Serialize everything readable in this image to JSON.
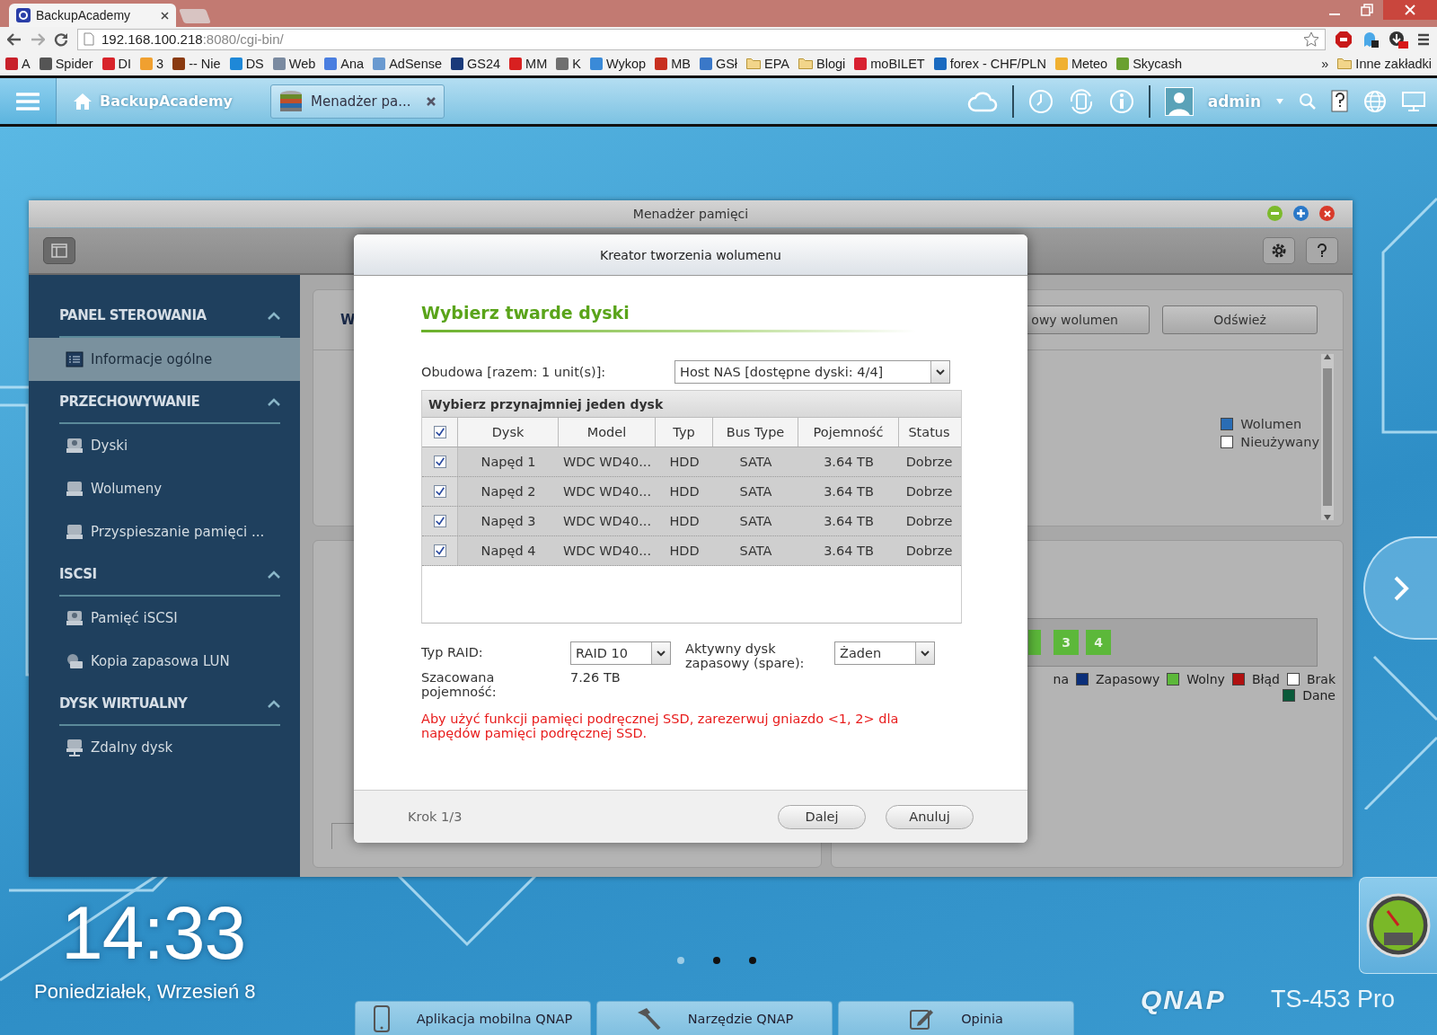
{
  "browser": {
    "tab_title": "BackupAcademy",
    "address_host": "192.168.100.218",
    "address_rest": ":8080/cgi-bin/"
  },
  "bookmarks": [
    {
      "label": "A",
      "kind": "site",
      "color": "#c8202a"
    },
    {
      "label": "Spider",
      "kind": "site",
      "color": "#555555"
    },
    {
      "label": "DI",
      "kind": "site",
      "color": "#d8232a"
    },
    {
      "label": "3",
      "kind": "site",
      "color": "#f0a030"
    },
    {
      "label": "-- Nie",
      "kind": "site",
      "color": "#8a3a10"
    },
    {
      "label": "DS",
      "kind": "site",
      "color": "#1e88d8"
    },
    {
      "label": "Web",
      "kind": "site",
      "color": "#7a8aa0"
    },
    {
      "label": "Ana",
      "kind": "site",
      "color": "#4a7ee0"
    },
    {
      "label": "AdSense",
      "kind": "site",
      "color": "#6a9ad0"
    },
    {
      "label": "GS24",
      "kind": "site",
      "color": "#1a3a7a"
    },
    {
      "label": "MM",
      "kind": "site",
      "color": "#d82020"
    },
    {
      "label": "K",
      "kind": "site",
      "color": "#707070"
    },
    {
      "label": "Wykop",
      "kind": "site",
      "color": "#3a8ad8"
    },
    {
      "label": "MB",
      "kind": "site",
      "color": "#c83020"
    },
    {
      "label": "GSł",
      "kind": "site",
      "color": "#3a78c8"
    },
    {
      "label": "EPA",
      "kind": "folder"
    },
    {
      "label": "Blogi",
      "kind": "folder"
    },
    {
      "label": "moBILET",
      "kind": "site",
      "color": "#d82030"
    },
    {
      "label": "forex - CHF/PLN",
      "kind": "site",
      "color": "#1a6ac0"
    },
    {
      "label": "Meteo",
      "kind": "site",
      "color": "#f0b030"
    },
    {
      "label": "Skycash",
      "kind": "site",
      "color": "#6aa030"
    }
  ],
  "bookmarks_more": "»",
  "other_bookmarks": {
    "label": "Inne zakładki",
    "kind": "folder"
  },
  "qnap_bar": {
    "home": "BackupAcademy",
    "app_tab": "Menadżer pa...",
    "user": "admin"
  },
  "window": {
    "title": "Menadżer pamięci"
  },
  "sidebar": {
    "sections": [
      {
        "title": "PANEL STEROWANIA",
        "expanded": true,
        "items": [
          {
            "label": "Informacje ogólne",
            "kind": "list",
            "selected": true
          }
        ]
      },
      {
        "title": "PRZECHOWYWANIE",
        "expanded": true,
        "items": [
          {
            "label": "Dyski",
            "kind": "disk",
            "selected": false
          },
          {
            "label": "Wolumeny",
            "kind": "volume",
            "selected": false
          },
          {
            "label": "Przyspieszanie pamięci ...",
            "kind": "volume",
            "selected": false
          }
        ]
      },
      {
        "title": "ISCSI",
        "expanded": true,
        "items": [
          {
            "label": "Pamięć iSCSI",
            "kind": "disk",
            "selected": false
          },
          {
            "label": "Kopia zapasowa LUN",
            "kind": "backup",
            "selected": false
          }
        ]
      },
      {
        "title": "DYSK WIRTUALNY",
        "expanded": true,
        "items": [
          {
            "label": "Zdalny dysk",
            "kind": "remote",
            "selected": false
          }
        ]
      }
    ]
  },
  "background": {
    "tab_fragment": "W",
    "buttons": [
      "owy wolumen",
      "Odśwież"
    ],
    "legend_top": [
      {
        "label": "Wolumen",
        "color": "#2a6db5"
      },
      {
        "label": "Nieużywany",
        "color": "#ffffff"
      }
    ],
    "slots": [
      {
        "label": "3"
      },
      {
        "label": "4"
      }
    ],
    "legend_bottom": [
      {
        "label": "na"
      },
      {
        "label": "Zapasowy",
        "color": "#0b2f7a"
      },
      {
        "label": "Wolny",
        "color": "#5cb83a"
      },
      {
        "label": "Błąd",
        "color": "#b01010"
      },
      {
        "label": "Brak",
        "color": "#ffffff"
      },
      {
        "label": "Dane",
        "color": "#0a5a3a"
      }
    ]
  },
  "dialog": {
    "title": "Kreator tworzenia wolumenu",
    "heading": "Wybierz twarde dyski",
    "enclosure_label": "Obudowa [razem: 1 unit(s)]:",
    "enclosure_value": "Host NAS [dostępne dyski: 4/4]",
    "table": {
      "caption": "Wybierz przynajmniej jeden dysk",
      "all_checked": true,
      "columns": [
        "Dysk",
        "Model",
        "Typ",
        "Bus Type",
        "Pojemność",
        "Status"
      ],
      "rows": [
        {
          "checked": true,
          "cells": [
            "Napęd 1",
            "WDC WD40...",
            "HDD",
            "SATA",
            "3.64 TB",
            "Dobrze"
          ]
        },
        {
          "checked": true,
          "cells": [
            "Napęd 2",
            "WDC WD40...",
            "HDD",
            "SATA",
            "3.64 TB",
            "Dobrze"
          ]
        },
        {
          "checked": true,
          "cells": [
            "Napęd 3",
            "WDC WD40...",
            "HDD",
            "SATA",
            "3.64 TB",
            "Dobrze"
          ]
        },
        {
          "checked": true,
          "cells": [
            "Napęd 4",
            "WDC WD40...",
            "HDD",
            "SATA",
            "3.64 TB",
            "Dobrze"
          ]
        }
      ]
    },
    "raid_label": "Typ RAID:",
    "raid_value": "RAID 10",
    "spare_label": "Aktywny dysk zapasowy (spare):",
    "spare_value": "Żaden",
    "capacity_label": "Szacowana pojemność:",
    "capacity_value": "7.26 TB",
    "warning": "Aby użyć funkcji pamięci podręcznej SSD, zarezerwuj gniazdo <1, 2> dla napędów pamięci podręcznej SSD.",
    "step": "Krok 1/3",
    "buttons": [
      "Dalej",
      "Anuluj"
    ]
  },
  "desktop": {
    "time": "14:33",
    "date": "Poniedziałek, Wrzesień 8",
    "pages": [
      {
        "selected": true
      },
      {
        "selected": false
      },
      {
        "selected": false
      }
    ],
    "dock": [
      {
        "label": "Aplikacja mobilna QNAP",
        "kind": "phone"
      },
      {
        "label": "Narzędzie QNAP",
        "kind": "hammer"
      },
      {
        "label": "Opinia",
        "kind": "edit"
      }
    ],
    "brand": "QNAP",
    "model": "TS-453 Pro"
  }
}
